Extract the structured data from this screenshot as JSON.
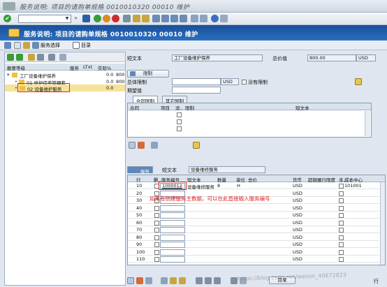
{
  "window": {
    "title": "服务说明: 项目的请购单规格 0010010320 00010 维护"
  },
  "header": {
    "title": "服务说明: 项目的请购单规格 0010010320 00010 维护"
  },
  "app_toolbar": {
    "service_select": "服务选择",
    "catalog": "目录"
  },
  "left_panel": {
    "columns": [
      "概要等级",
      "服务",
      "LTxt",
      "实际%"
    ],
    "rows": [
      {
        "label": "工厂设备维护保养",
        "pct": "0.0",
        "val": "800"
      },
      {
        "label": "01 维护保养管理套",
        "pct": "0.0",
        "val": "800"
      },
      {
        "label": "02 设备维护服务",
        "pct": "0.0",
        "val": ""
      }
    ]
  },
  "top": {
    "short_text_label": "短文本",
    "short_text_value": "工厂设备维护保养",
    "total_label": "总价值",
    "total_value": "800.00",
    "currency": "USD"
  },
  "limit": {
    "button": "限制",
    "overall_label": "总体限制",
    "currency": "USD",
    "no_limit": "没有限制",
    "expected_label": "期望值",
    "tabs": [
      "合同限制",
      "其它限制"
    ],
    "columns": [
      "合同",
      "项目",
      "没..",
      "限制",
      "短文本"
    ]
  },
  "services": {
    "tab": "服务",
    "short_text_label": "短文本",
    "short_text_value": "设备维修服务",
    "columns": [
      "行",
      "删..",
      "服务编号",
      "短文本",
      "数量",
      "单位",
      "总价",
      "货币",
      "超额履行限度",
      "未..",
      "成本中心"
    ],
    "rows": [
      {
        "line": "10",
        "service_no": "1000012",
        "text": "设备维修服务",
        "qty": "8",
        "unit": "H",
        "curr": "USD",
        "cost_center": "101001"
      },
      {
        "line": "20",
        "service_no": "",
        "text": "",
        "qty": "",
        "unit": "",
        "curr": "USD",
        "cost_center": ""
      },
      {
        "line": "30",
        "service_no": "",
        "text": "",
        "qty": "",
        "unit": "",
        "curr": "USD",
        "cost_center": ""
      },
      {
        "line": "40",
        "service_no": "",
        "text": "",
        "qty": "",
        "unit": "",
        "curr": "USD",
        "cost_center": ""
      },
      {
        "line": "50",
        "service_no": "",
        "text": "",
        "qty": "",
        "unit": "",
        "curr": "USD",
        "cost_center": ""
      },
      {
        "line": "60",
        "service_no": "",
        "text": "",
        "qty": "",
        "unit": "",
        "curr": "USD",
        "cost_center": ""
      },
      {
        "line": "70",
        "service_no": "",
        "text": "",
        "qty": "",
        "unit": "",
        "curr": "USD",
        "cost_center": ""
      },
      {
        "line": "80",
        "service_no": "",
        "text": "",
        "qty": "",
        "unit": "",
        "curr": "USD",
        "cost_center": ""
      },
      {
        "line": "90",
        "service_no": "",
        "text": "",
        "qty": "",
        "unit": "",
        "curr": "USD",
        "cost_center": ""
      },
      {
        "line": "100",
        "service_no": "",
        "text": "",
        "qty": "",
        "unit": "",
        "curr": "USD",
        "cost_center": ""
      },
      {
        "line": "110",
        "service_no": "",
        "text": "",
        "qty": "",
        "unit": "",
        "curr": "USD",
        "cost_center": ""
      }
    ],
    "annotation": "如果有创建服务主数据，可以在此直接输入服务编号",
    "catalog_button": "目录",
    "line_label": "行"
  },
  "watermark": "https://blog.csdn.net/weixin_40672823",
  "colors": {
    "header": "#1f5fae",
    "highlight": "#e02020",
    "folder": "#f0c040"
  }
}
